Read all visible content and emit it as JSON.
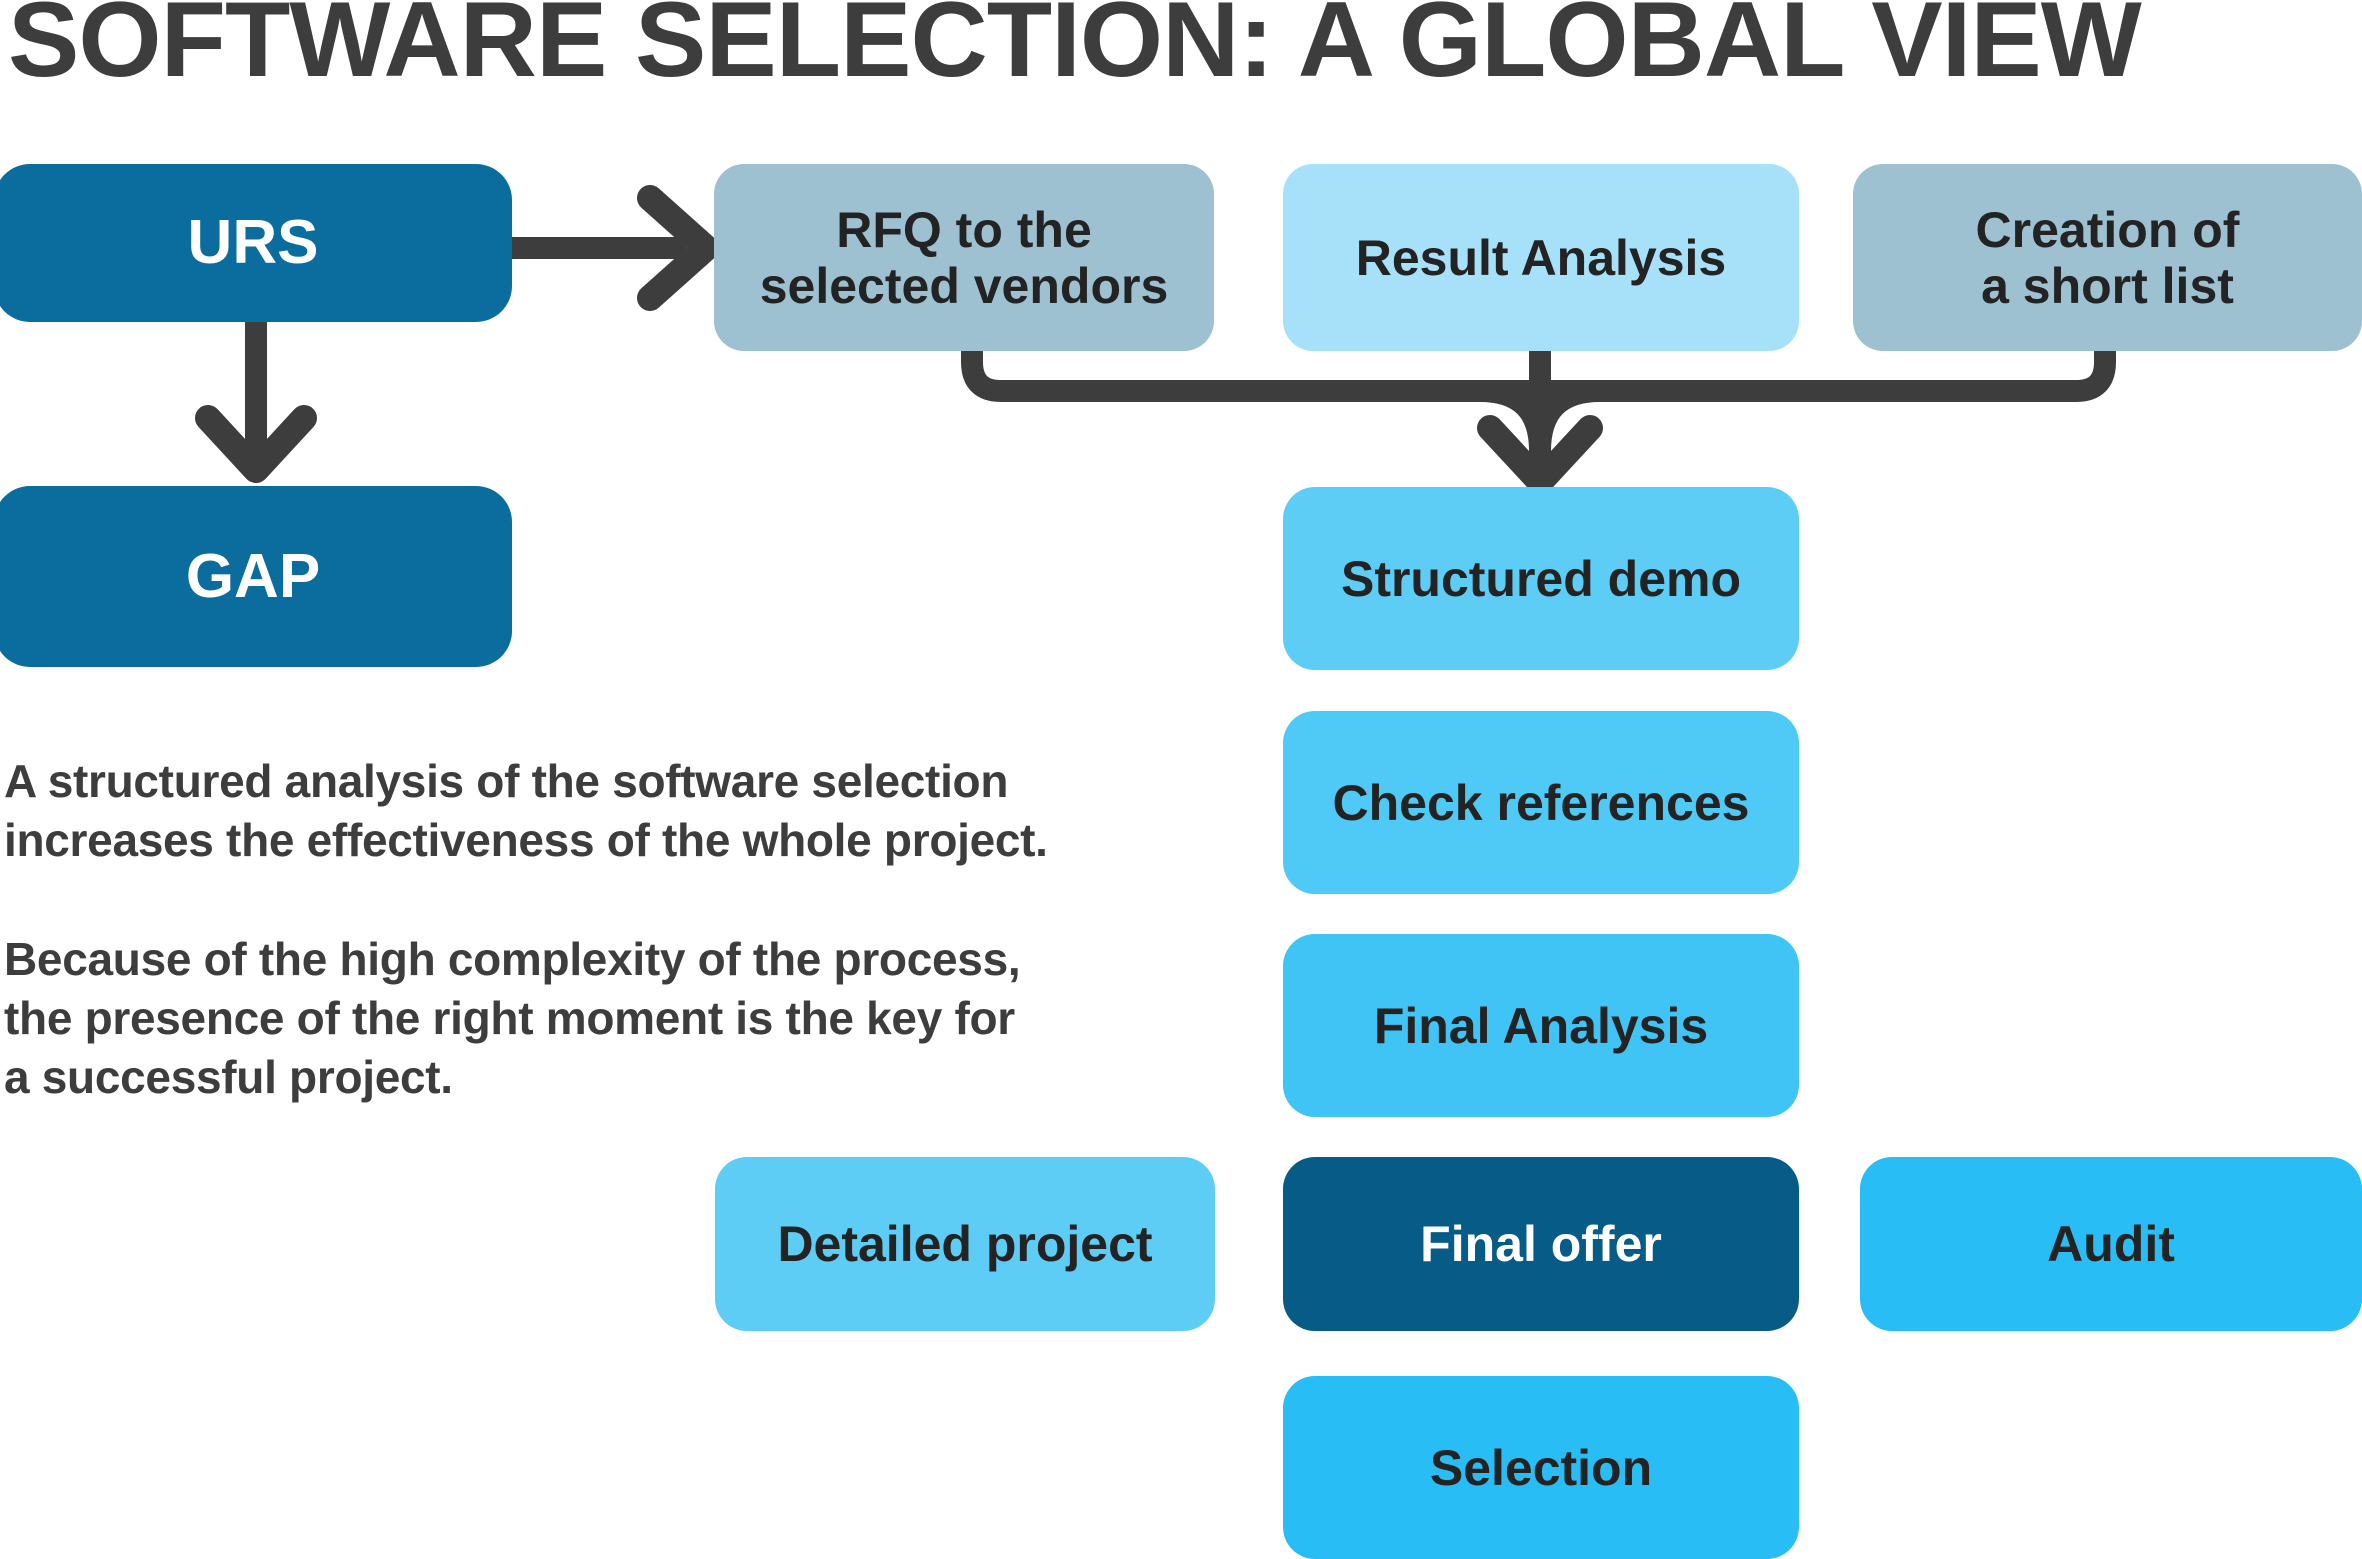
{
  "page": {
    "title": "SOFTWARE SELECTION: A GLOBAL VIEW",
    "background": "#ffffff",
    "title_color": "#3d3d3d",
    "connector_color": "#3d3d3d"
  },
  "colors": {
    "dark_blue": "#0a6d9e",
    "deep_blue": "#065b87",
    "gray_blue": "#9ec1d2",
    "pale_sky": "#a6e1f9",
    "sky": "#5ecdf5",
    "bright_blue": "#29bdf5",
    "text_dark": "#232323",
    "text_white": "#ffffff"
  },
  "nodes": [
    {
      "id": "urs",
      "label": "URS",
      "fill": "#0a6d9e",
      "text_color": "#ffffff",
      "font_size": 62
    },
    {
      "id": "rfq",
      "label": "RFQ to the\nselected vendors",
      "fill": "#9ec1d2",
      "text_color": "#232323",
      "font_size": 50
    },
    {
      "id": "result-analysis",
      "label": "Result Analysis",
      "fill": "#a6e1f9",
      "text_color": "#232323",
      "font_size": 50
    },
    {
      "id": "short-list",
      "label": "Creation of\na short list",
      "fill": "#9ec1d2",
      "text_color": "#232323",
      "font_size": 50
    },
    {
      "id": "gap",
      "label": "GAP",
      "fill": "#0a6d9e",
      "text_color": "#ffffff",
      "font_size": 62
    },
    {
      "id": "structured-demo",
      "label": "Structured demo",
      "fill": "#5ecdf5",
      "text_color": "#232323",
      "font_size": 50
    },
    {
      "id": "check-references",
      "label": "Check references",
      "fill": "#4fc9f5",
      "text_color": "#232323",
      "font_size": 50
    },
    {
      "id": "final-analysis",
      "label": "Final Analysis",
      "fill": "#3fc4f5",
      "text_color": "#232323",
      "font_size": 50
    },
    {
      "id": "detailed-project",
      "label": "Detailed project",
      "fill": "#5ecdf5",
      "text_color": "#232323",
      "font_size": 50
    },
    {
      "id": "final-offer",
      "label": "Final offer",
      "fill": "#065b87",
      "text_color": "#ffffff",
      "font_size": 50
    },
    {
      "id": "audit",
      "label": "Audit",
      "fill": "#29bdf5",
      "text_color": "#232323",
      "font_size": 50
    },
    {
      "id": "selection",
      "label": "Selection",
      "fill": "#29bdf5",
      "text_color": "#232323",
      "font_size": 50
    }
  ],
  "paragraphs": {
    "first": "A structured analysis of the software selection\nincreases the effectiveness of the whole project.",
    "second": "Because of the high complexity of the process,\nthe presence of the right moment is the key for\na successful project."
  }
}
